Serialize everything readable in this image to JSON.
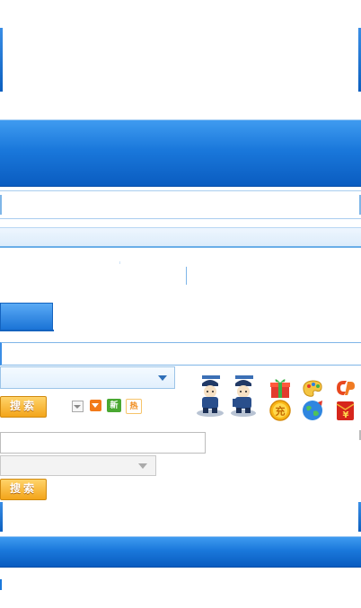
{
  "search": {
    "button_label": "搜索",
    "button_label_2": "搜索",
    "tag_new": "新",
    "tag_hot": "热",
    "coin_text": "充",
    "yen_text": "¥"
  },
  "colors": {
    "accent_blue": "#1a78db",
    "orange": "#f3a51a",
    "green": "#4aa832"
  },
  "icons": [
    "police-icon",
    "police-icon-2",
    "gift-icon",
    "palette-icon",
    "cp-logo-icon",
    "coin-icon",
    "globe-icon",
    "shopping-bag-icon",
    "yen-envelope-icon"
  ]
}
